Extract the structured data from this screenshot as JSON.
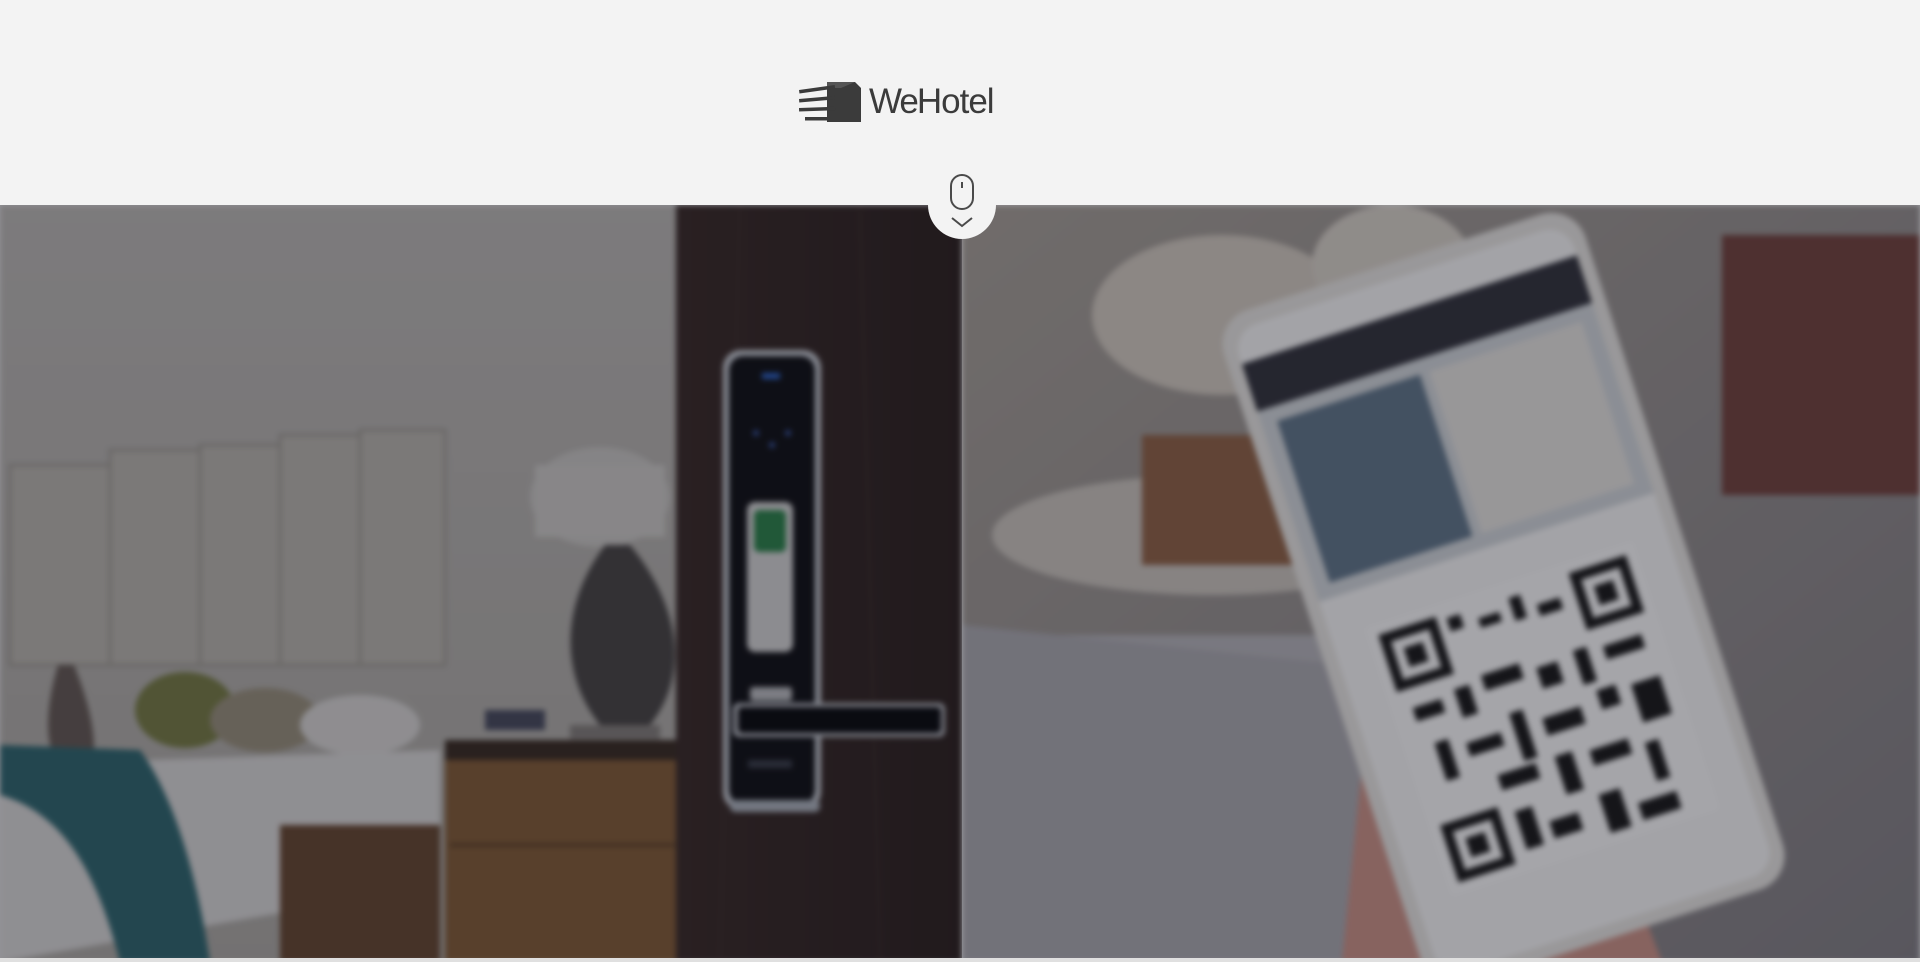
{
  "header": {
    "brand": {
      "prefix": "We",
      "suffix": "Hotel",
      "icon": "wehotel-building-logo-icon"
    }
  },
  "scroll_hint": {
    "icon": "mouse-scroll-icon",
    "arrow_icon": "chevron-down-icon"
  },
  "hero": {
    "left_panel": {
      "image": "hotel-room-smart-door-lock-image"
    },
    "right_panel": {
      "image": "phone-qr-code-check-in-image"
    }
  },
  "colors": {
    "background": "#f3f3f3",
    "logo": "#3b3b3b",
    "overlay": "#1c1c28"
  }
}
